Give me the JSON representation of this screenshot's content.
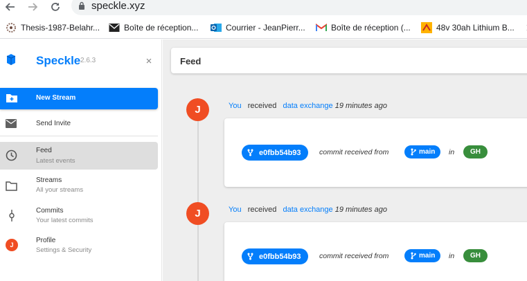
{
  "browser": {
    "url": "speckle.xyz",
    "bookmarks": [
      {
        "label": "Thesis-1987-Belahr...",
        "icon": "thesis-favicon-icon"
      },
      {
        "label": "Boîte de réception...",
        "icon": "mail-envelope-icon"
      },
      {
        "label": "Courrier - JeanPierr...",
        "icon": "outlook-icon"
      },
      {
        "label": "Boîte de réception (...",
        "icon": "gmail-icon"
      },
      {
        "label": "48v 30ah Lithium B...",
        "icon": "aliexpress-icon"
      }
    ]
  },
  "sidebar": {
    "brand": "Speckle",
    "version": "2.6.3",
    "new_stream": "New Stream",
    "send_invite": "Send Invite",
    "items": [
      {
        "title": "Feed",
        "subtitle": "Latest events"
      },
      {
        "title": "Streams",
        "subtitle": "All your streams"
      },
      {
        "title": "Commits",
        "subtitle": "Your latest commits"
      },
      {
        "title": "Profile",
        "subtitle": "Settings & Security"
      }
    ],
    "profile_initial": "J"
  },
  "main": {
    "header_title": "Feed",
    "activities": [
      {
        "avatar": "J",
        "actor": "You",
        "verb": "received",
        "object": "data exchange",
        "time": "19 minutes ago",
        "commit_id": "e0fbb54b93",
        "message": "commit received from",
        "branch": "main",
        "in_label": "in",
        "app": "GH"
      },
      {
        "avatar": "J",
        "actor": "You",
        "verb": "received",
        "object": "data exchange",
        "time": "19 minutes ago",
        "commit_id": "e0fbb54b93",
        "message": "commit received from",
        "branch": "main",
        "in_label": "in",
        "app": "GH"
      }
    ]
  },
  "colors": {
    "accent": "#047efb",
    "avatar": "#f04d23",
    "app_chip": "#388e3c",
    "main_bg": "#eeeeee"
  }
}
